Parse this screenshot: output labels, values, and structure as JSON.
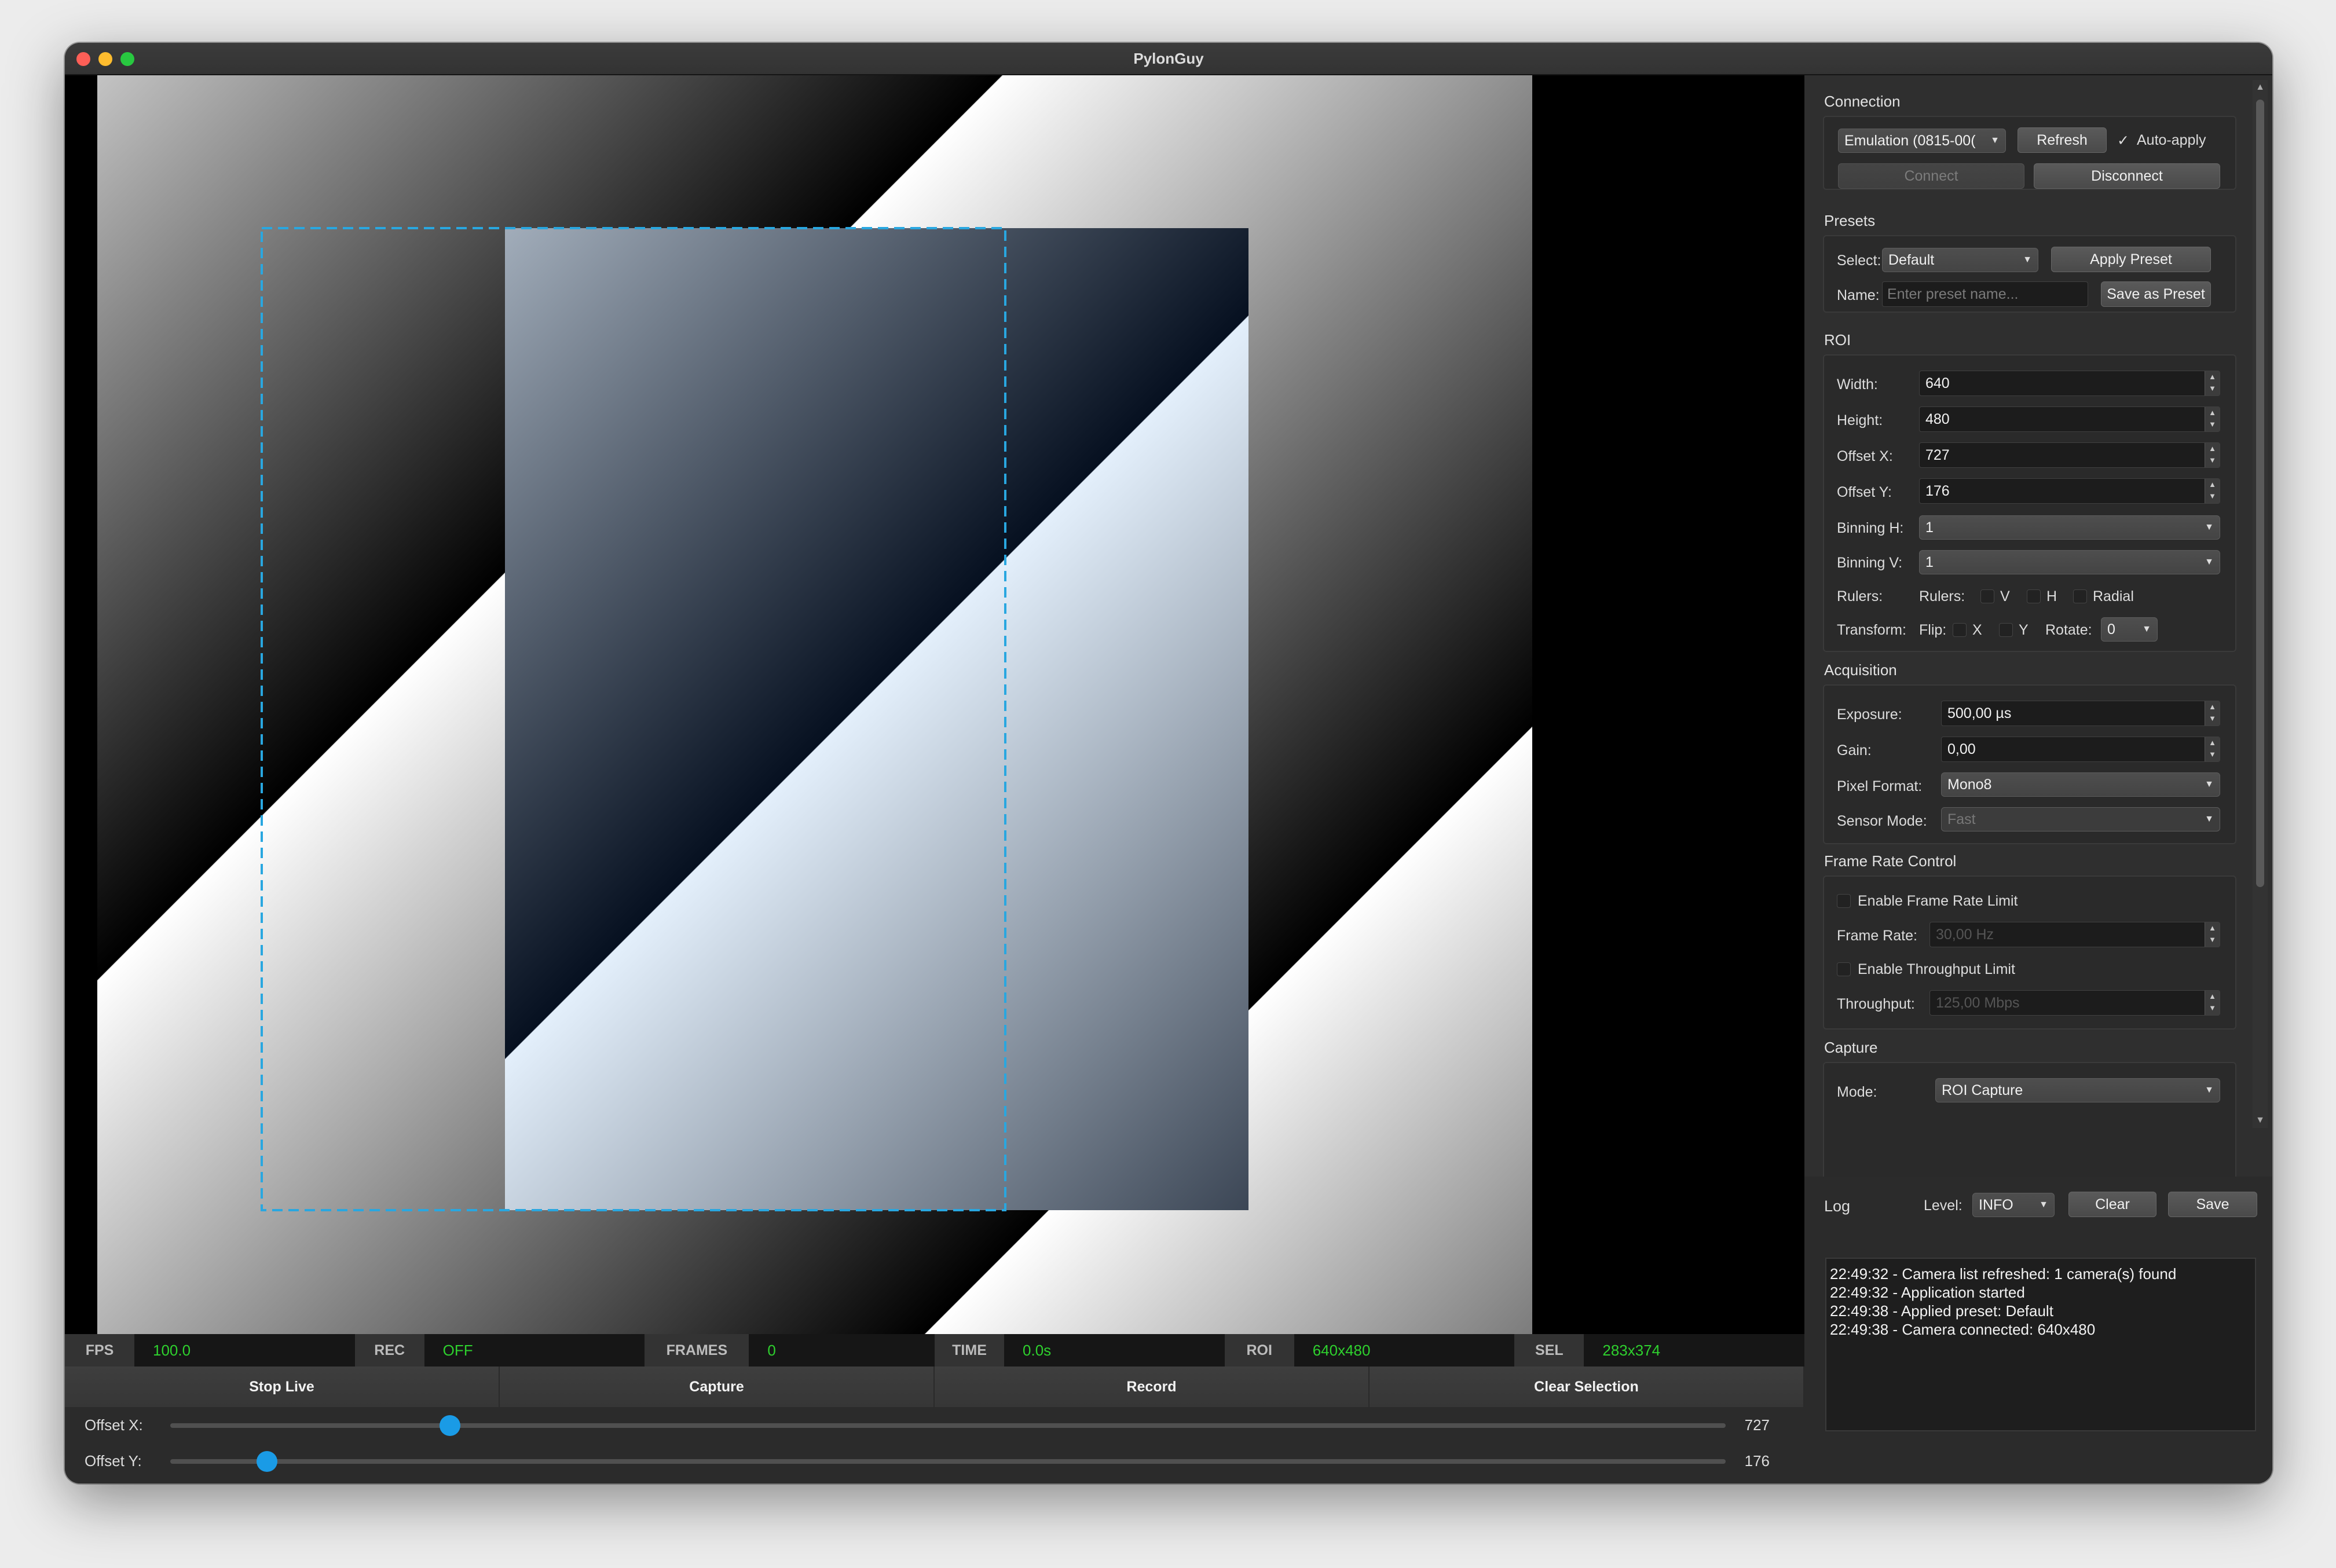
{
  "window": {
    "title": "PylonGuy"
  },
  "status": [
    {
      "label": "FPS",
      "value": "100.0"
    },
    {
      "label": "REC",
      "value": "OFF"
    },
    {
      "label": "FRAMES",
      "value": "0"
    },
    {
      "label": "TIME",
      "value": "0.0s"
    },
    {
      "label": "ROI",
      "value": "640x480"
    },
    {
      "label": "SEL",
      "value": "283x374"
    }
  ],
  "actions": [
    "Stop Live",
    "Capture",
    "Record",
    "Clear Selection"
  ],
  "sliders": [
    {
      "label": "Offset X:",
      "value": 727,
      "fraction": 0.18
    },
    {
      "label": "Offset Y:",
      "value": 176,
      "fraction": 0.062
    }
  ],
  "connection": {
    "title": "Connection",
    "camera": "Emulation (0815-00(",
    "refresh": "Refresh",
    "auto_apply": "Auto-apply",
    "auto_check": "✓",
    "connect": "Connect",
    "disconnect": "Disconnect"
  },
  "presets": {
    "title": "Presets",
    "select_label": "Select:",
    "selected": "Default",
    "apply": "Apply Preset",
    "name_label": "Name:",
    "name_placeholder": "Enter preset name...",
    "save": "Save as Preset"
  },
  "roi": {
    "title": "ROI",
    "width_label": "Width:",
    "width": "640",
    "height_label": "Height:",
    "height": "480",
    "offx_label": "Offset X:",
    "offx": "727",
    "offy_label": "Offset Y:",
    "offy": "176",
    "binh_label": "Binning H:",
    "binh": "1",
    "binv_label": "Binning V:",
    "binv": "1",
    "rulers_label": "Rulers:",
    "rulers_inner": "Rulers:",
    "v": "V",
    "h": "H",
    "radial": "Radial",
    "transform_label": "Transform:",
    "flip": "Flip:",
    "x": "X",
    "y": "Y",
    "rotate_label": "Rotate:",
    "rotate": "0"
  },
  "acquisition": {
    "title": "Acquisition",
    "exposure_label": "Exposure:",
    "exposure": "500,00 µs",
    "gain_label": "Gain:",
    "gain": "0,00",
    "pixfmt_label": "Pixel Format:",
    "pixfmt": "Mono8",
    "sensor_label": "Sensor Mode:",
    "sensor": "Fast"
  },
  "framerate": {
    "title": "Frame Rate Control",
    "enable_limit": "Enable Frame Rate Limit",
    "rate_label": "Frame Rate:",
    "rate": "30,00 Hz",
    "enable_tp": "Enable Throughput Limit",
    "tp_label": "Throughput:",
    "tp": "125,00 Mbps"
  },
  "capture": {
    "title": "Capture",
    "mode_label": "Mode:",
    "mode": "ROI Capture"
  },
  "log": {
    "title": "Log",
    "level_label": "Level:",
    "level": "INFO",
    "clear": "Clear",
    "save": "Save",
    "lines": [
      "22:49:32 - Camera list refreshed: 1 camera(s) found",
      "22:49:32 - Application started",
      "22:49:38 - Applied preset: Default",
      "22:49:38 - Camera connected: 640x480"
    ]
  },
  "colors": {
    "accent": "#1a9be6",
    "status_value": "#2ed12e",
    "selection": "#29a7e0"
  }
}
